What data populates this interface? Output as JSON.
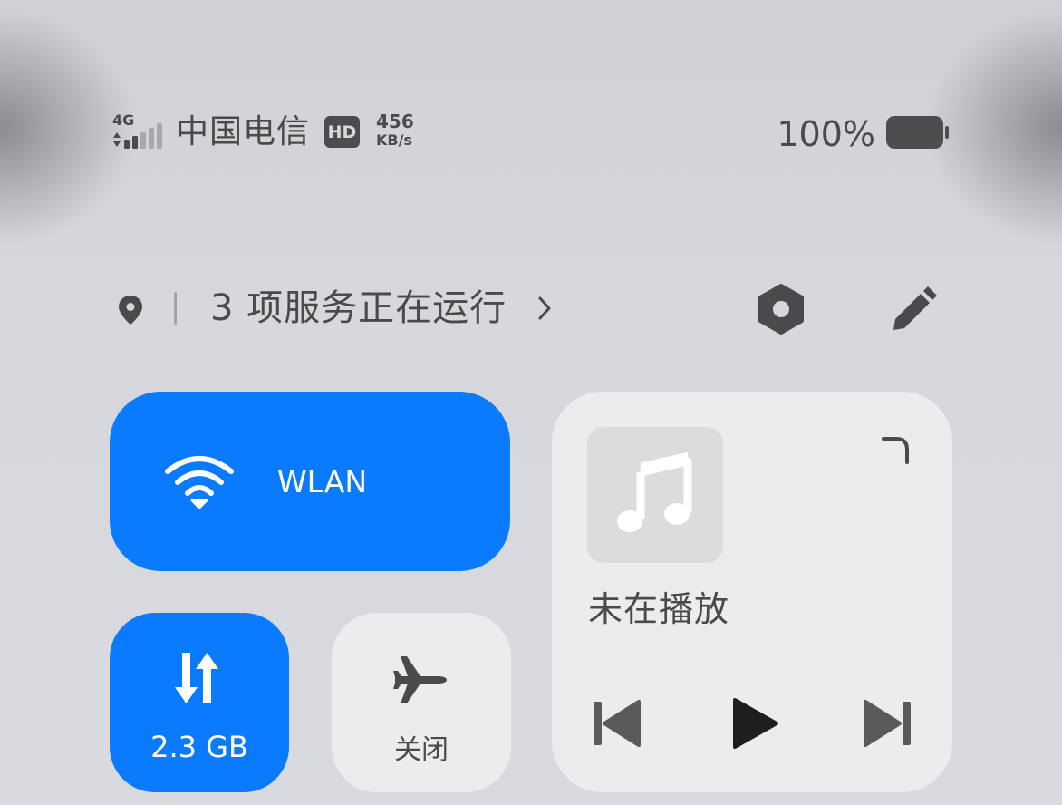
{
  "status_bar": {
    "network_type": "4G",
    "carrier": "中国电信",
    "hd_badge": "HD",
    "speed_value": "456",
    "speed_unit": "KB/s",
    "battery_percent": "100%"
  },
  "services": {
    "text": "3 项服务正在运行",
    "icons": [
      "location-icon",
      "chevron-right-icon",
      "settings-icon",
      "edit-icon"
    ]
  },
  "tiles": {
    "wlan": {
      "label": "WLAN",
      "icon": "wifi-icon",
      "active": true
    },
    "mobile_data": {
      "label": "2.3 GB",
      "icon": "data-transfer-icon",
      "active": true
    },
    "airplane": {
      "label": "关闭",
      "icon": "airplane-icon",
      "active": false
    }
  },
  "media": {
    "status": "未在播放",
    "icons": [
      "music-note-icon",
      "expand-icon",
      "previous-icon",
      "play-icon",
      "next-icon"
    ]
  },
  "colors": {
    "accent": "#0a7bfe",
    "background": "#d4d6da",
    "tile_inactive": "#ececee",
    "text": "#4a4a4d"
  }
}
